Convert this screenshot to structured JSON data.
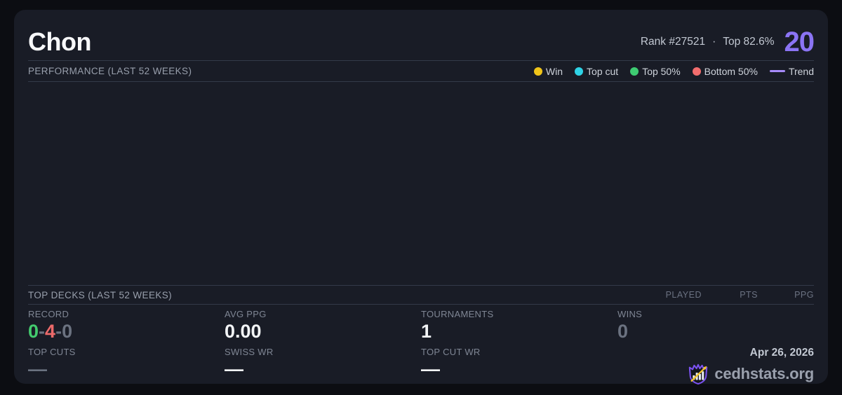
{
  "header": {
    "title": "Chon",
    "rank": "Rank #27521",
    "dot": "·",
    "top_pct": "Top 82.6%",
    "score": "20",
    "score_color": "#8b74f4"
  },
  "performance": {
    "section_title": "PERFORMANCE (LAST 52 WEEKS)",
    "legend": [
      {
        "label": "Win",
        "color": "#f0c419"
      },
      {
        "label": "Top cut",
        "color": "#2fd3e6"
      },
      {
        "label": "Top 50%",
        "color": "#3ecb72"
      },
      {
        "label": "Bottom 50%",
        "color": "#f26d6d"
      },
      {
        "label": "Trend",
        "color": "#a78bfa"
      }
    ]
  },
  "chart_data": {
    "type": "scatter",
    "title": "PERFORMANCE (LAST 52 WEEKS)",
    "x": [],
    "series": [],
    "note": "plot area is rendered empty in the screenshot (no data points, axes or gridlines visible)"
  },
  "top_decks": {
    "section_title": "TOP DECKS (LAST 52 WEEKS)",
    "columns": [
      "PLAYED",
      "PTS",
      "PPG"
    ],
    "rows": []
  },
  "stats": {
    "record": {
      "label": "RECORD",
      "wins": "0",
      "losses": "4",
      "draws": "0",
      "separator": "-",
      "win_color": "#43cb6e",
      "loss_color": "#ec6a6a",
      "draw_color": "#6b7280"
    },
    "avg_ppg": {
      "label": "AVG PPG",
      "value": "0.00"
    },
    "tournaments": {
      "label": "TOURNAMENTS",
      "value": "1"
    },
    "wins": {
      "label": "WINS",
      "value": "0"
    },
    "top_cuts": {
      "label": "TOP CUTS",
      "value": "—"
    },
    "swiss_wr": {
      "label": "SWISS WR",
      "value": "—"
    },
    "top_cut_wr": {
      "label": "TOP CUT WR",
      "value": "—"
    }
  },
  "footer": {
    "date": "Apr 26, 2026",
    "brand": "cedhstats.org"
  }
}
